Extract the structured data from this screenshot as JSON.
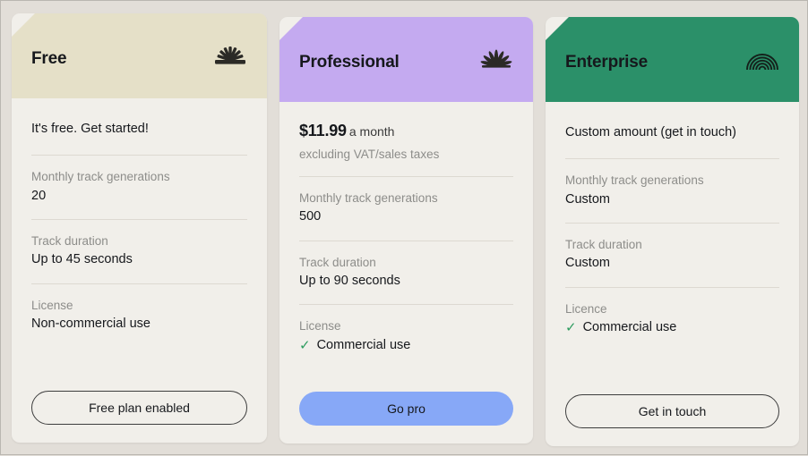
{
  "colors": {
    "page_background": "#e2ded8",
    "card_background": "#f1efea",
    "free_header": "#e5e0c8",
    "professional_header": "#c4aaf0",
    "enterprise_header": "#2b9069",
    "go_pro_button": "#87a8f7",
    "check_green": "#2e9c5f",
    "label_gray": "#8d8d8a"
  },
  "plans": [
    {
      "id": "free",
      "title": "Free",
      "icon": "sunburst-icon",
      "headline": "It's free. Get started!",
      "features": [
        {
          "label": "Monthly track generations",
          "value": "20",
          "has_check": false
        },
        {
          "label": "Track duration",
          "value": "Up to 45 seconds",
          "has_check": false
        },
        {
          "label": "License",
          "value": "Non-commercial use",
          "has_check": false
        }
      ],
      "cta_label": "Free plan enabled",
      "cta_style": "outline"
    },
    {
      "id": "professional",
      "title": "Professional",
      "icon": "fan-petals-icon",
      "price_amount": "$11.99",
      "price_period": "a month",
      "price_note": "excluding VAT/sales taxes",
      "features": [
        {
          "label": "Monthly track generations",
          "value": "500",
          "has_check": false
        },
        {
          "label": "Track duration",
          "value": "Up to 90 seconds",
          "has_check": false
        },
        {
          "label": "License",
          "value": "Commercial use",
          "has_check": true
        }
      ],
      "cta_label": "Go pro",
      "cta_style": "filled"
    },
    {
      "id": "enterprise",
      "title": "Enterprise",
      "icon": "concentric-arcs-icon",
      "headline": "Custom amount (get in touch)",
      "features": [
        {
          "label": "Monthly track generations",
          "value": "Custom",
          "has_check": false
        },
        {
          "label": "Track duration",
          "value": "Custom",
          "has_check": false
        },
        {
          "label": "Licence",
          "value": "Commercial use",
          "has_check": true
        }
      ],
      "cta_label": "Get in touch",
      "cta_style": "outline"
    }
  ],
  "check_glyph": "✓"
}
